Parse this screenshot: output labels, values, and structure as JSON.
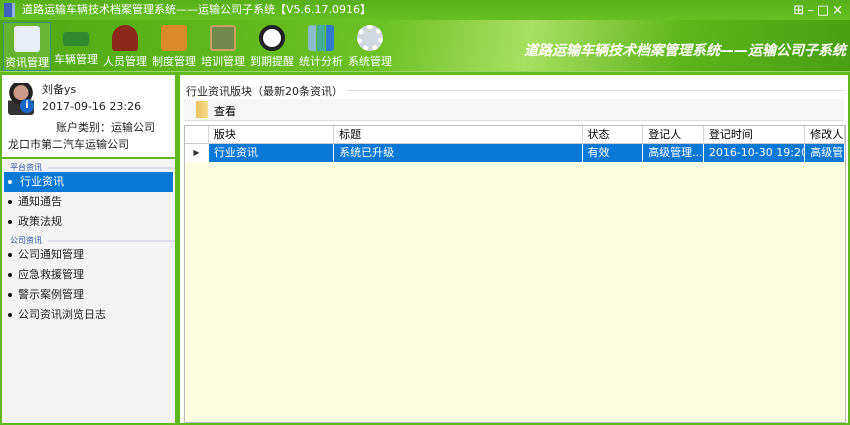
{
  "window": {
    "title": "道路运输车辆技术档案管理系统——运输公司子系统【V5.6.17.0916】",
    "controls": "⊞–□×"
  },
  "toolbar": {
    "items": [
      {
        "label": "资讯管理",
        "color": "#e8eef8"
      },
      {
        "label": "车辆管理",
        "color": "#2f8a2f"
      },
      {
        "label": "人员管理",
        "color": "#8b2a1a"
      },
      {
        "label": "制度管理",
        "color": "#d9882a"
      },
      {
        "label": "培训管理",
        "color": "#6f8a4a"
      },
      {
        "label": "到期提醒",
        "color": "#222222"
      },
      {
        "label": "统计分析",
        "color": "#2f7ad0"
      },
      {
        "label": "系统管理",
        "color": "#d0d8e0"
      }
    ],
    "brand": "道路运输车辆技术档案管理系统——运输公司子系统"
  },
  "user": {
    "name": "刘备ys",
    "datetime": "2017-09-16 23:26",
    "account_type": "账户类别：运输公司",
    "company": "龙口市第二汽车运输公司"
  },
  "sidebar": {
    "sections": [
      {
        "title": "平台资讯",
        "items": [
          "行业资讯",
          "通知通告",
          "政策法规"
        ]
      },
      {
        "title": "公司资讯",
        "items": [
          "公司通知管理",
          "应急救援管理",
          "警示案例管理",
          "公司资讯浏览日志"
        ]
      }
    ]
  },
  "main": {
    "group_title": "行业资讯版块（最新20条资讯）",
    "view_label": "查看",
    "columns": [
      "版块",
      "标题",
      "状态",
      "登记人",
      "登记时间",
      "修改人"
    ],
    "rows": [
      [
        "行业资讯",
        "系统已升级",
        "有效",
        "高级管理...",
        "2016-10-30 19:20",
        "高级管"
      ]
    ]
  }
}
